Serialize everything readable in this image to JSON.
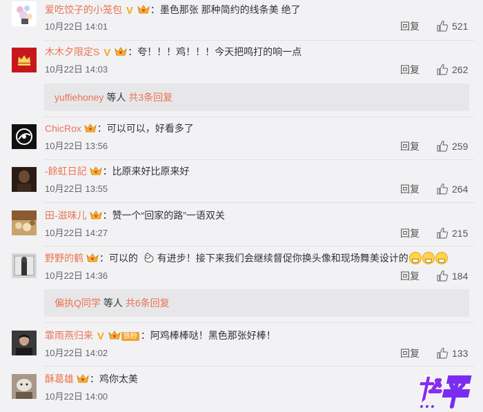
{
  "comments": [
    {
      "user": "爱吃饺子的小笼包",
      "verified": true,
      "text": "墨色那张 那种简约的线条美 绝了",
      "time": "10月22日 14:01",
      "reply": "回复",
      "likes": "521"
    },
    {
      "user": "木木夕限定S",
      "verified": true,
      "text": "夸！！！鸡！！！今天把鸣打的响一点",
      "time": "10月22日 14:03",
      "reply": "回复",
      "likes": "262"
    },
    {
      "user": "ChicRox",
      "text": "可以可以，好看多了",
      "time": "10月22日 13:56",
      "reply": "回复",
      "likes": "259"
    },
    {
      "user": "-餘虹日記",
      "text": "比原来好比原来好",
      "time": "10月22日 13:55",
      "reply": "回复",
      "likes": "264"
    },
    {
      "user": "田-滋味儿",
      "text": "赞一个“回家的路”一语双关",
      "time": "10月22日 14:27",
      "reply": "回复",
      "likes": "215"
    },
    {
      "user": "野野的鹤",
      "text_a": "可以的",
      "text_b": "有进步！接下来我们会继续督促你换头像和现场舞美设计的",
      "time": "10月22日 14:36",
      "reply": "回复",
      "likes": "184"
    },
    {
      "user": "霏雨燕归来",
      "verified": true,
      "fan_badge": "铁粉",
      "text": "阿鸡棒棒哒！黑色那张好棒！",
      "time": "10月22日 14:02",
      "reply": "回复",
      "likes": "133"
    },
    {
      "user": "酥葛雄",
      "text": "鸡你太美",
      "time": "10月22日 14:00"
    }
  ],
  "more_replies": [
    {
      "user": "yuffiehoney",
      "text": "等人",
      "count": "共3条回复"
    },
    {
      "user": "偏执Q同学",
      "text": "等人",
      "count": "共6条回复"
    }
  ],
  "icons": [
    "crown-badge-icon",
    "verified-v-icon",
    "thumb-up-icon",
    "grin-emoji-icon",
    "chick-emoji-icon"
  ],
  "colors": {
    "username": "#eb7350",
    "background": "#f2f2f5",
    "verified": "#f5a623",
    "logo": "#7a2cf0"
  }
}
